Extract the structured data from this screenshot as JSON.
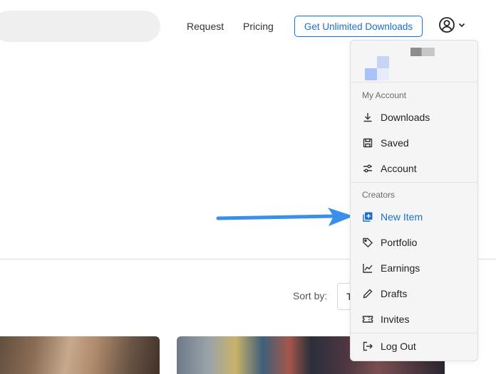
{
  "header": {
    "nav": {
      "request": "Request",
      "pricing": "Pricing"
    },
    "cta_label": "Get Unlimited Downloads"
  },
  "toolbar": {
    "sort_label": "Sort by:",
    "sort_value": "T"
  },
  "menu": {
    "sections": {
      "account": "My Account",
      "creators": "Creators"
    },
    "items": {
      "downloads": "Downloads",
      "saved": "Saved",
      "account": "Account",
      "new_item": "New Item",
      "portfolio": "Portfolio",
      "earnings": "Earnings",
      "drafts": "Drafts",
      "invites": "Invites",
      "logout": "Log Out"
    }
  },
  "colors": {
    "accent": "#1a6fd0",
    "arrow": "#3a8fea"
  }
}
